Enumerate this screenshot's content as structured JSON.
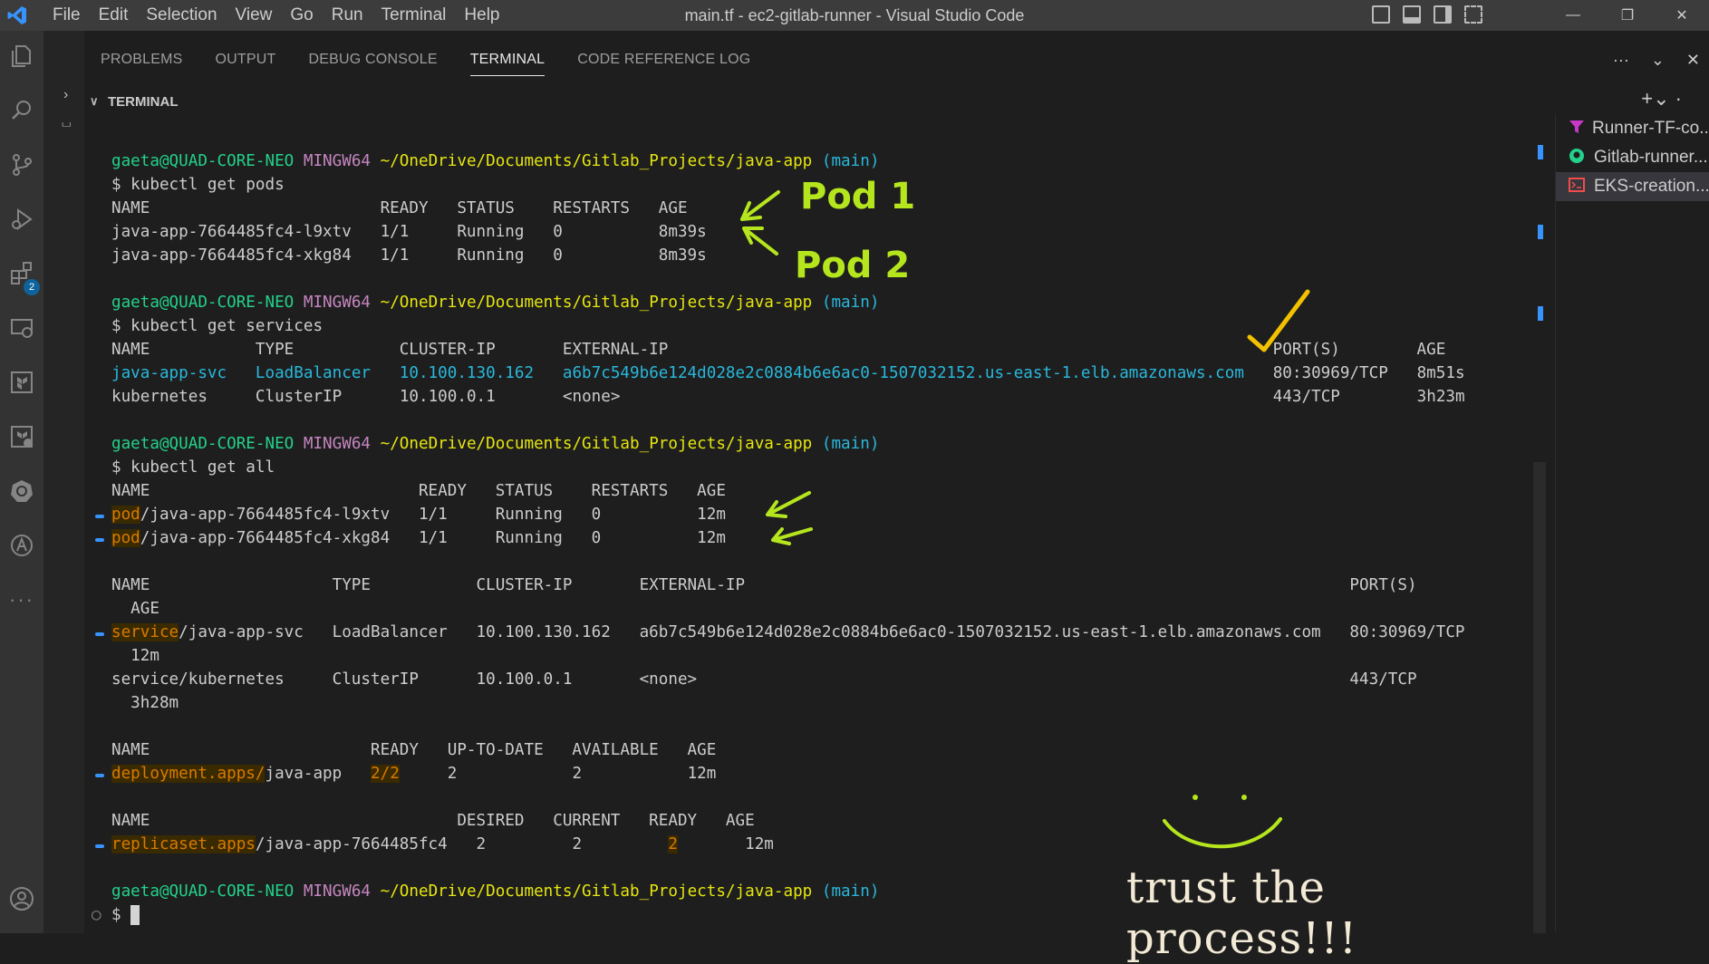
{
  "titlebar": {
    "menu": [
      "File",
      "Edit",
      "Selection",
      "View",
      "Go",
      "Run",
      "Terminal",
      "Help"
    ],
    "title": "main.tf - ec2-gitlab-runner - Visual Studio Code"
  },
  "panel": {
    "tabs": [
      "PROBLEMS",
      "OUTPUT",
      "DEBUG CONSOLE",
      "TERMINAL",
      "CODE REFERENCE LOG"
    ],
    "active_tab": "TERMINAL",
    "section_title": "TERMINAL"
  },
  "activity_bar": {
    "icons": [
      "explorer-icon",
      "search-icon",
      "source-control-icon",
      "run-debug-icon",
      "extensions-icon",
      "remote-explorer-icon",
      "terraform-icon",
      "terraform-cloud-icon",
      "kubernetes-icon",
      "aws-toolkit-icon",
      "more-icon",
      "account-icon"
    ],
    "extensions_badge": "2"
  },
  "terminal_list": [
    {
      "name": "Runner-TF-co...",
      "icon": "filter-icon"
    },
    {
      "name": "Gitlab-runner...",
      "icon": "github-icon"
    },
    {
      "name": "EKS-creation...",
      "icon": "terminal-icon"
    }
  ],
  "terminal": {
    "prompt": {
      "user": "gaeta@QUAD-CORE-NEO",
      "env": "MINGW64",
      "path": "~/OneDrive/Documents/Gitlab_Projects/java-app",
      "branch": "(main)"
    },
    "cmd1": "$ kubectl get pods",
    "pods_header": "NAME                        READY   STATUS    RESTARTS   AGE",
    "pods_rows": [
      "java-app-7664485fc4-l9xtv   1/1     Running   0          8m39s",
      "java-app-7664485fc4-xkg84   1/1     Running   0          8m39s"
    ],
    "cmd2": "$ kubectl get services",
    "svc_header": "NAME           TYPE           CLUSTER-IP       EXTERNAL-IP                                                               PORT(S)        AGE",
    "svc_rows": [
      {
        "name": "java-app-svc",
        "type": "LoadBalancer",
        "cip": "10.100.130.162",
        "eip": "a6b7c549b6e124d028e2c0884b6e6ac0-1507032152.us-east-1.elb.amazonaws.com",
        "port": "80:30969/TCP",
        "age": "8m51s"
      },
      {
        "name": "kubernetes",
        "type": "ClusterIP",
        "cip": "10.100.0.1",
        "eip": "<none>",
        "port": "443/TCP",
        "age": "3h23m"
      }
    ],
    "cmd3": "$ kubectl get all",
    "all_pods_header": "NAME                            READY   STATUS    RESTARTS   AGE",
    "all_pods_rows": [
      {
        "kind": "pod",
        "rest": "/java-app-7664485fc4-l9xtv   1/1     Running   0          12m"
      },
      {
        "kind": "pod",
        "rest": "/java-app-7664485fc4-xkg84   1/1     Running   0          12m"
      }
    ],
    "all_svc_header": "NAME                   TYPE           CLUSTER-IP       EXTERNAL-IP                                                               PORT(S)",
    "all_svc_age_header": "  AGE",
    "all_svc_rows": [
      {
        "kind": "service",
        "rest": "/java-app-svc   LoadBalancer   10.100.130.162   a6b7c549b6e124d028e2c0884b6e6ac0-1507032152.us-east-1.elb.amazonaws.com   80:30969/TCP",
        "age": "  12m"
      },
      {
        "kind": "",
        "rest": "service/kubernetes     ClusterIP      10.100.0.1       <none>                                                                    443/TCP",
        "age": "  3h28m"
      }
    ],
    "deploy_header": "NAME                       READY   UP-TO-DATE   AVAILABLE   AGE",
    "deploy_row": {
      "kind": "deployment.apps/",
      "name": "java-app",
      "ready": "2/2",
      "rest": "     2            2           12m"
    },
    "rs_header": "NAME                                DESIRED   CURRENT   READY   AGE",
    "rs_row": {
      "kind": "replicaset.apps",
      "name": "/java-app-7664485fc4",
      "mid": "   2         2         ",
      "ready": "2",
      "rest": "       12m"
    },
    "final_prompt_char": "$"
  },
  "annotations": {
    "pod1": "Pod 1",
    "pod2": "Pod 2",
    "slogan": "trust the process!!!"
  }
}
